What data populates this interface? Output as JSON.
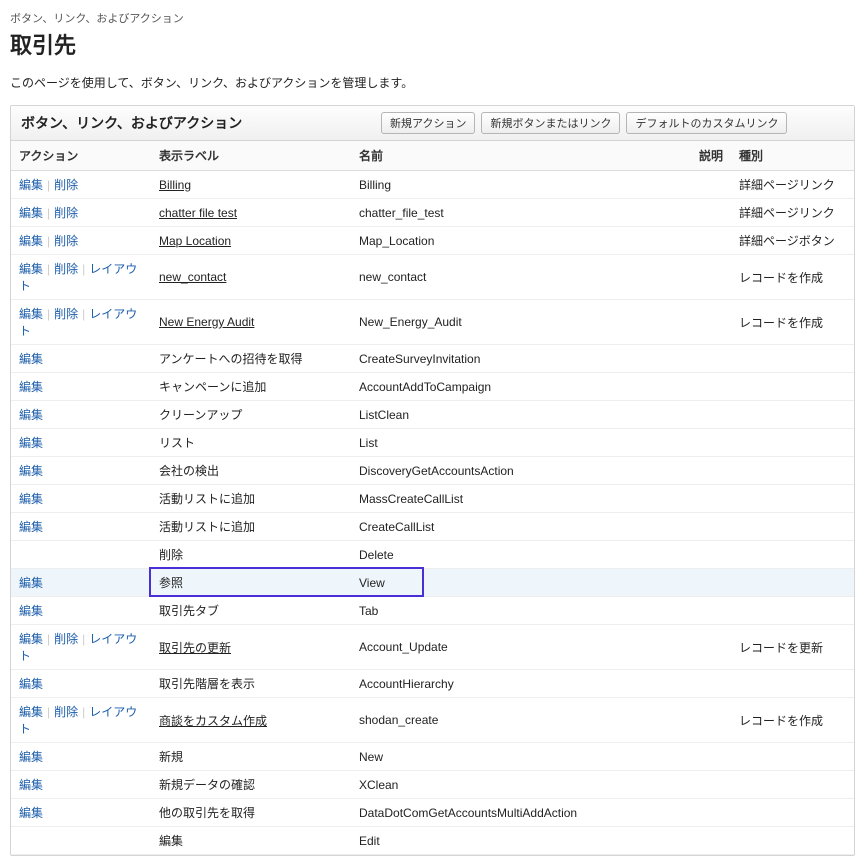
{
  "breadcrumb": "ボタン、リンク、およびアクション",
  "page_title": "取引先",
  "page_desc": "このページを使用して、ボタン、リンク、およびアクションを管理します。",
  "panel_title": "ボタン、リンク、およびアクション",
  "buttons": {
    "new_action": "新規アクション",
    "new_button_link": "新規ボタンまたはリンク",
    "default_custom_link": "デフォルトのカスタムリンク"
  },
  "columns": {
    "action": "アクション",
    "label": "表示ラベル",
    "name": "名前",
    "desc": "説明",
    "kind": "種別"
  },
  "action_labels": {
    "edit": "編集",
    "delete": "削除",
    "layout": "レイアウト"
  },
  "rows": [
    {
      "actions": [
        "edit",
        "delete"
      ],
      "label": "Billing",
      "label_link": true,
      "name": "Billing",
      "kind": "詳細ページリンク"
    },
    {
      "actions": [
        "edit",
        "delete"
      ],
      "label": "chatter file test",
      "label_link": true,
      "name": "chatter_file_test",
      "kind": "詳細ページリンク"
    },
    {
      "actions": [
        "edit",
        "delete"
      ],
      "label": "Map Location",
      "label_link": true,
      "name": "Map_Location",
      "kind": "詳細ページボタン"
    },
    {
      "actions": [
        "edit",
        "delete",
        "layout"
      ],
      "label": "new_contact",
      "label_link": true,
      "name": "new_contact",
      "kind": "レコードを作成"
    },
    {
      "actions": [
        "edit",
        "delete",
        "layout"
      ],
      "label": "New Energy Audit",
      "label_link": true,
      "name": "New_Energy_Audit",
      "kind": "レコードを作成"
    },
    {
      "actions": [
        "edit"
      ],
      "label": "アンケートへの招待を取得",
      "name": "CreateSurveyInvitation"
    },
    {
      "actions": [
        "edit"
      ],
      "label": "キャンペーンに追加",
      "name": "AccountAddToCampaign"
    },
    {
      "actions": [
        "edit"
      ],
      "label": "クリーンアップ",
      "name": "ListClean"
    },
    {
      "actions": [
        "edit"
      ],
      "label": "リスト",
      "name": "List"
    },
    {
      "actions": [
        "edit"
      ],
      "label": "会社の検出",
      "name": "DiscoveryGetAccountsAction"
    },
    {
      "actions": [
        "edit"
      ],
      "label": "活動リストに追加",
      "name": "MassCreateCallList"
    },
    {
      "actions": [
        "edit"
      ],
      "label": "活動リストに追加",
      "name": "CreateCallList"
    },
    {
      "actions": [],
      "label": "削除",
      "name": "Delete"
    },
    {
      "actions": [
        "edit"
      ],
      "label": "参照",
      "name": "View",
      "highlight": true
    },
    {
      "actions": [
        "edit"
      ],
      "label": "取引先タブ",
      "name": "Tab"
    },
    {
      "actions": [
        "edit",
        "delete",
        "layout"
      ],
      "label": "取引先の更新",
      "label_link": true,
      "name": "Account_Update",
      "kind": "レコードを更新"
    },
    {
      "actions": [
        "edit"
      ],
      "label": "取引先階層を表示",
      "name": "AccountHierarchy"
    },
    {
      "actions": [
        "edit",
        "delete",
        "layout"
      ],
      "label": "商談をカスタム作成",
      "label_link": true,
      "name": "shodan_create",
      "kind": "レコードを作成"
    },
    {
      "actions": [
        "edit"
      ],
      "label": "新規",
      "name": "New"
    },
    {
      "actions": [
        "edit"
      ],
      "label": "新規データの確認",
      "name": "XClean"
    },
    {
      "actions": [
        "edit"
      ],
      "label": "他の取引先を取得",
      "name": "DataDotComGetAccountsMultiAddAction"
    },
    {
      "actions": [],
      "label": "編集",
      "name": "Edit"
    }
  ]
}
